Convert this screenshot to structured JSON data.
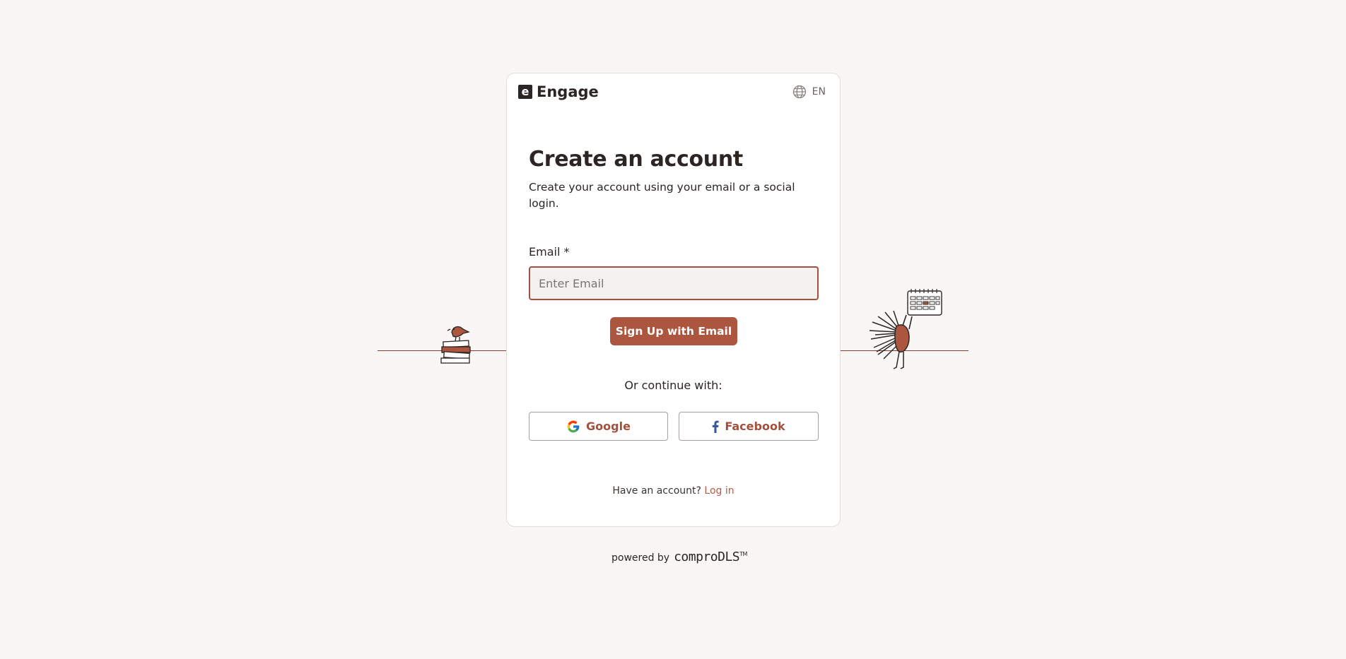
{
  "brand": {
    "name": "Engage",
    "logo_letter": "e"
  },
  "language": {
    "icon": "globe-icon",
    "code": "EN"
  },
  "heading": {
    "title": "Create an account",
    "subtitle": "Create your account using your email or a social login."
  },
  "email": {
    "label": "Email *",
    "placeholder": "Enter Email",
    "value": ""
  },
  "signup_button": {
    "label": "Sign Up with Email"
  },
  "social": {
    "divider_text": "Or continue with:",
    "google": {
      "label": "Google",
      "icon": "google-icon"
    },
    "facebook": {
      "label": "Facebook",
      "icon": "facebook-icon"
    }
  },
  "footer": {
    "prompt": "Have an account?",
    "login_link": "Log in"
  },
  "powered_by": {
    "text": "powered by",
    "brand": "comproDLS",
    "trademark": "TM"
  },
  "colors": {
    "accent": "#ad563f",
    "accent_text": "#a3513e",
    "background": "#f9f7f5",
    "card": "#ffffff",
    "text": "#2b2523"
  }
}
